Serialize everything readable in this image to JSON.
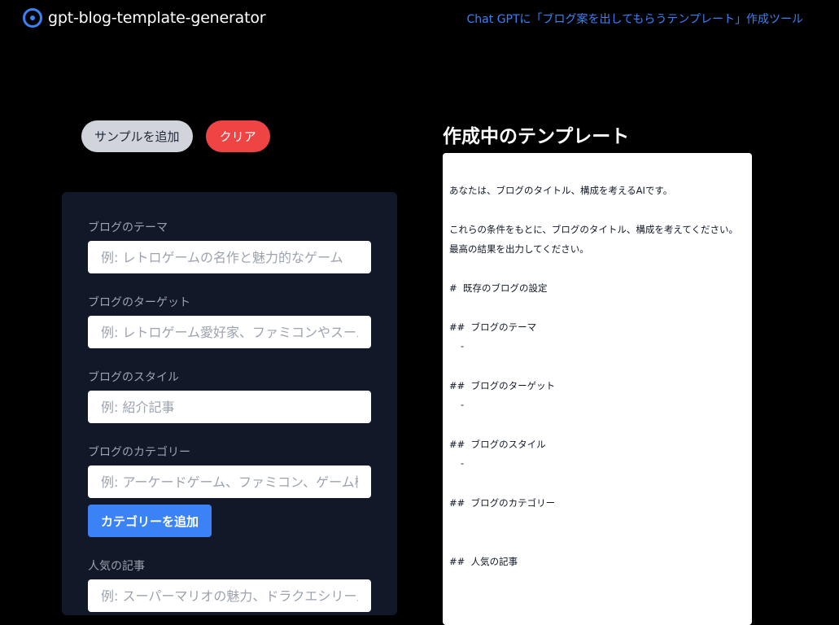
{
  "header": {
    "app_name": "gpt-blog-template-generator",
    "link_text": "Chat GPTに「ブログ案を出してもらうテンプレート」作成ツール"
  },
  "actions": {
    "sample_label": "サンプルを追加",
    "clear_label": "クリア"
  },
  "form": {
    "theme": {
      "label": "ブログのテーマ",
      "placeholder": "例: レトロゲームの名作と魅力的なゲーム"
    },
    "target": {
      "label": "ブログのターゲット",
      "placeholder": "例: レトロゲーム愛好家、ファミコンやスーパーファミコン"
    },
    "style": {
      "label": "ブログのスタイル",
      "placeholder": "例: 紹介記事"
    },
    "category": {
      "label": "ブログのカテゴリー",
      "placeholder": "例: アーケードゲーム、ファミコン、ゲーム機"
    },
    "add_category_label": "カテゴリーを追加",
    "popular": {
      "label": "人気の記事",
      "placeholder": "例: スーパーマリオの魅力、ドラクエシリーズ"
    }
  },
  "preview": {
    "title": "作成中のテンプレート",
    "intro": "あなたは、ブログのタイトル、構成を考えるAIです。",
    "instruction1": "これらの条件をもとに、ブログのタイトル、構成を考えてください。",
    "instruction2": "最高の結果を出力してください。",
    "h_settings": "#  既存のブログの設定",
    "h_theme": "##  ブログのテーマ",
    "theme_value": "-",
    "h_target": "##  ブログのターゲット",
    "target_value": "-",
    "h_style": "##  ブログのスタイル",
    "style_value": "-",
    "h_category": "##  ブログのカテゴリー",
    "h_popular": "##  人気の記事"
  }
}
